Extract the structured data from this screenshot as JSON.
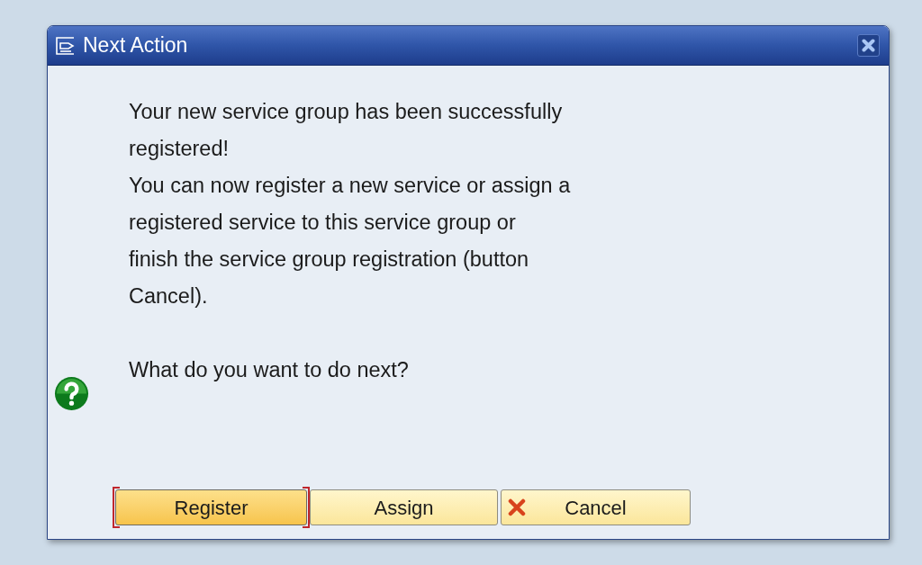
{
  "window": {
    "title": "Next Action"
  },
  "message": [
    "Your new service group has been successfully\nregistered!",
    "You can now register a new service or assign a\nregistered service to this service group or\nfinish the service group registration (button\nCancel)."
  ],
  "question": "What do you want to do next?",
  "buttons": [
    {
      "label": "Register",
      "kind": "plain",
      "selected": true
    },
    {
      "label": "Assign",
      "kind": "plain",
      "selected": false
    },
    {
      "label": "Cancel",
      "kind": "cancel",
      "selected": false
    }
  ]
}
